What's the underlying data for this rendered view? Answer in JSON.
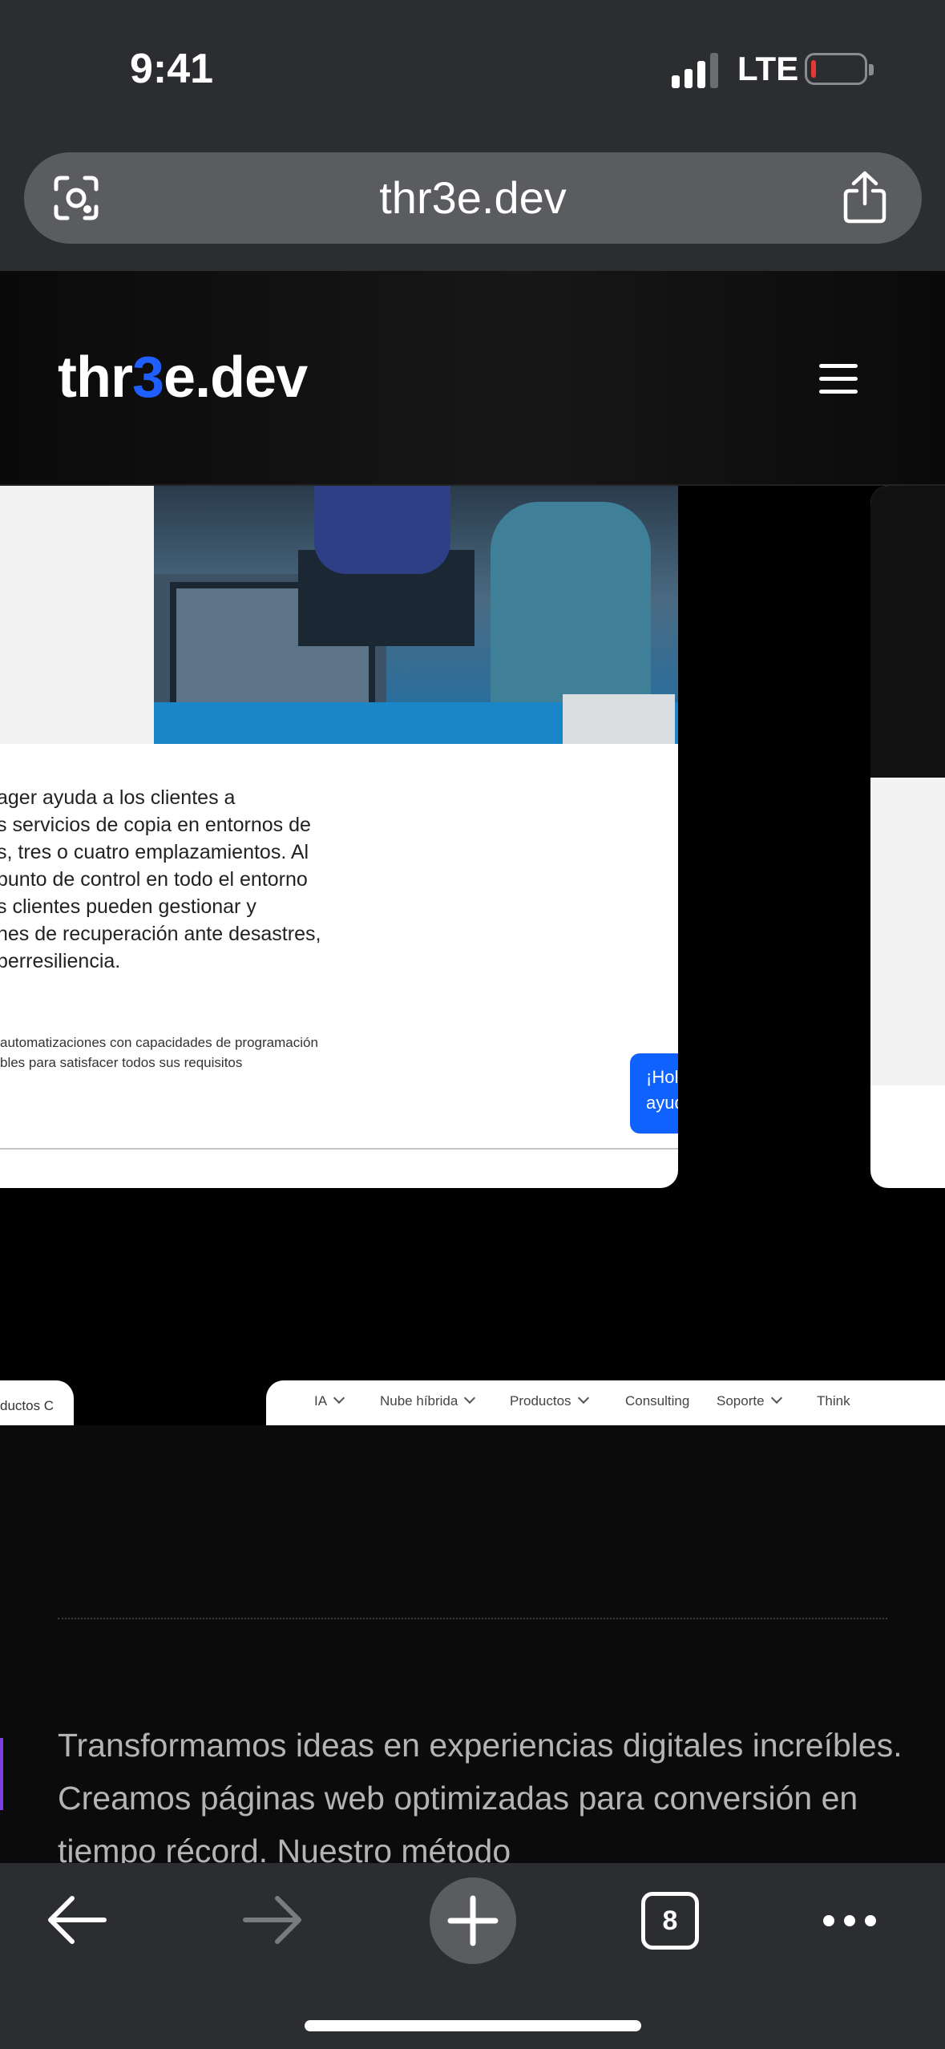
{
  "status_bar": {
    "time": "9:41",
    "network": "LTE",
    "battery_level": 0.05
  },
  "browser": {
    "url": "thr3e.dev",
    "icons": {
      "lens": "visual-search-icon",
      "share": "share-icon"
    },
    "toolbar": {
      "tab_count": "8",
      "icons": [
        "back-arrow-icon",
        "forward-arrow-icon",
        "plus-icon",
        "tabs-icon",
        "more-icon"
      ]
    }
  },
  "site": {
    "logo": {
      "prefix": "thr",
      "accent": "3",
      "suffix": "e.dev",
      "accent_color": "#1f5fff"
    },
    "menu_icon": "hamburger-menu-icon",
    "showcase": {
      "card_body": "ager ayuda a los clientes a\ns servicios de copia en entornos de\ns, tres o cuatro emplazamientos. Al\npunto de control en todo el entorno\ns clientes pueden gestionar y\nnes de recuperación ante desastres,\nperresiliencia.",
      "card_small": "automatizaciones con capacidades de programación\nbles para satisfacer todos sus requisitos",
      "chat_bubble": "¡Hol\nayud",
      "nav_left": "ductos   C",
      "nav_items": [
        "IA",
        "Nube híbrida",
        "Productos",
        "Consulting",
        "Soporte",
        "Think"
      ]
    },
    "intro": "Transformamos ideas en experiencias digitales increíbles. Creamos páginas web optimizadas para conversión en tiempo récord. Nuestro método"
  }
}
